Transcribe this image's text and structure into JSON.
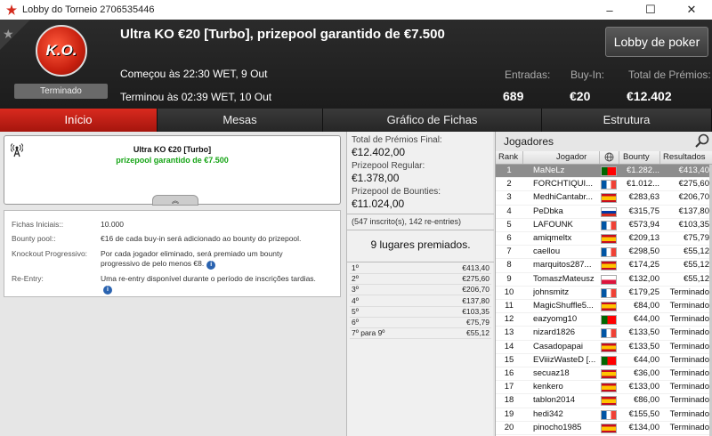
{
  "window": {
    "title": "Lobby do Torneio 2706535446",
    "controls": [
      "–",
      "☐",
      "✕"
    ]
  },
  "header": {
    "logo_text": "K.O.",
    "status": "Terminado",
    "title": "Ultra KO €20 [Turbo], prizepool garantido de €7.500",
    "lobby_button": "Lobby de poker",
    "started": "Começou às 22:30 WET, 9 Out",
    "ended": "Terminou às 02:39 WET, 10 Out",
    "entries_label": "Entradas:",
    "entries_value": "689",
    "buyin_label": "Buy-In:",
    "buyin_value": "€20",
    "prizes_label": "Total de Prémios:",
    "prizes_value": "€12.402"
  },
  "tabs": [
    "Início",
    "Mesas",
    "Gráfico de Fichas",
    "Estrutura"
  ],
  "info": {
    "line1": "Ultra KO €20 [Turbo]",
    "line2": "prizepool garantido de €7.500",
    "expand": "︽"
  },
  "details": [
    {
      "k": "Fichas Iniciais::",
      "v": "10.000"
    },
    {
      "k": "Bounty pool::",
      "v": "€16 de cada buy-in será adicionado ao bounty do prizepool."
    },
    {
      "k": "Knockout Progressivo:",
      "v": "Por cada jogador eliminado, será premiado um bounty progressivo de pelo menos €8."
    },
    {
      "k": "Re-Entry:",
      "v": "Uma re-entry disponível durante o período de inscrições tardias."
    }
  ],
  "prize": {
    "final_label": "Total de Prémios Final:",
    "final_value": "€12.402,00",
    "regular_label": "Prizepool Regular:",
    "regular_value": "€1.378,00",
    "bounties_label": "Prizepool de Bounties:",
    "bounties_value": "€11.024,00",
    "registered": "(547 inscrito(s), 142 re-entries)",
    "places": "9 lugares premiados.",
    "payouts": [
      {
        "p": "1º",
        "a": "€413,40"
      },
      {
        "p": "2º",
        "a": "€275,60"
      },
      {
        "p": "3º",
        "a": "€206,70"
      },
      {
        "p": "4º",
        "a": "€137,80"
      },
      {
        "p": "5º",
        "a": "€103,35"
      },
      {
        "p": "6º",
        "a": "€75,79"
      },
      {
        "p": "7º para 9º",
        "a": "€55,12"
      }
    ]
  },
  "players": {
    "title": "Jogadores",
    "columns": {
      "rank": "Rank",
      "player": "Jogador",
      "bounty": "Bounty",
      "result": "Resultados"
    },
    "rows": [
      {
        "r": "1",
        "n": "MaNeLz",
        "f": "pt",
        "b": "€1.282...",
        "s": "€413,40"
      },
      {
        "r": "2",
        "n": "FORCHTIQUI...",
        "f": "fr",
        "b": "€1.012...",
        "s": "€275,60"
      },
      {
        "r": "3",
        "n": "MedhiCantabr...",
        "f": "es",
        "b": "€283,63",
        "s": "€206,70"
      },
      {
        "r": "4",
        "n": "PeDbka",
        "f": "ru",
        "b": "€315,75",
        "s": "€137,80"
      },
      {
        "r": "5",
        "n": "LAFOUNK",
        "f": "fr",
        "b": "€573,94",
        "s": "€103,35"
      },
      {
        "r": "6",
        "n": "amiqmeltx",
        "f": "es",
        "b": "€209,13",
        "s": "€75,79"
      },
      {
        "r": "7",
        "n": "caellou",
        "f": "fr",
        "b": "€298,50",
        "s": "€55,12"
      },
      {
        "r": "8",
        "n": "marquitos287...",
        "f": "es",
        "b": "€174,25",
        "s": "€55,12"
      },
      {
        "r": "9",
        "n": "TomaszMateusz",
        "f": "pl",
        "b": "€132,00",
        "s": "€55,12"
      },
      {
        "r": "10",
        "n": "johnsmitz",
        "f": "fr",
        "b": "€179,25",
        "s": "Terminado"
      },
      {
        "r": "11",
        "n": "MagicShuffle5...",
        "f": "es",
        "b": "€84,00",
        "s": "Terminado"
      },
      {
        "r": "12",
        "n": "eazyomg10",
        "f": "pt",
        "b": "€44,00",
        "s": "Terminado"
      },
      {
        "r": "13",
        "n": "nizard1826",
        "f": "fr",
        "b": "€133,50",
        "s": "Terminado"
      },
      {
        "r": "14",
        "n": "Casadopapai",
        "f": "es",
        "b": "€133,50",
        "s": "Terminado"
      },
      {
        "r": "15",
        "n": "EViiizWasteD [...",
        "f": "pt",
        "b": "€44,00",
        "s": "Terminado"
      },
      {
        "r": "16",
        "n": "secuaz18",
        "f": "es",
        "b": "€36,00",
        "s": "Terminado"
      },
      {
        "r": "17",
        "n": "kenkero",
        "f": "es",
        "b": "€133,00",
        "s": "Terminado"
      },
      {
        "r": "18",
        "n": "tablon2014",
        "f": "es",
        "b": "€86,00",
        "s": "Terminado"
      },
      {
        "r": "19",
        "n": "hedi342",
        "f": "fr",
        "b": "€155,50",
        "s": "Terminado"
      },
      {
        "r": "20",
        "n": "pinocho1985",
        "f": "es",
        "b": "€134,00",
        "s": "Terminado"
      }
    ]
  },
  "flag_colors": {
    "pt": [
      "#006600",
      "#ff0000"
    ],
    "fr": [
      "#0055a4",
      "#ffffff",
      "#ef4135"
    ],
    "es": [
      "#c60b1e",
      "#ffc400",
      "#c60b1e"
    ],
    "ru": [
      "#ffffff",
      "#0039a6",
      "#d52b1e"
    ],
    "pl": [
      "#ffffff",
      "#dc143c"
    ]
  }
}
